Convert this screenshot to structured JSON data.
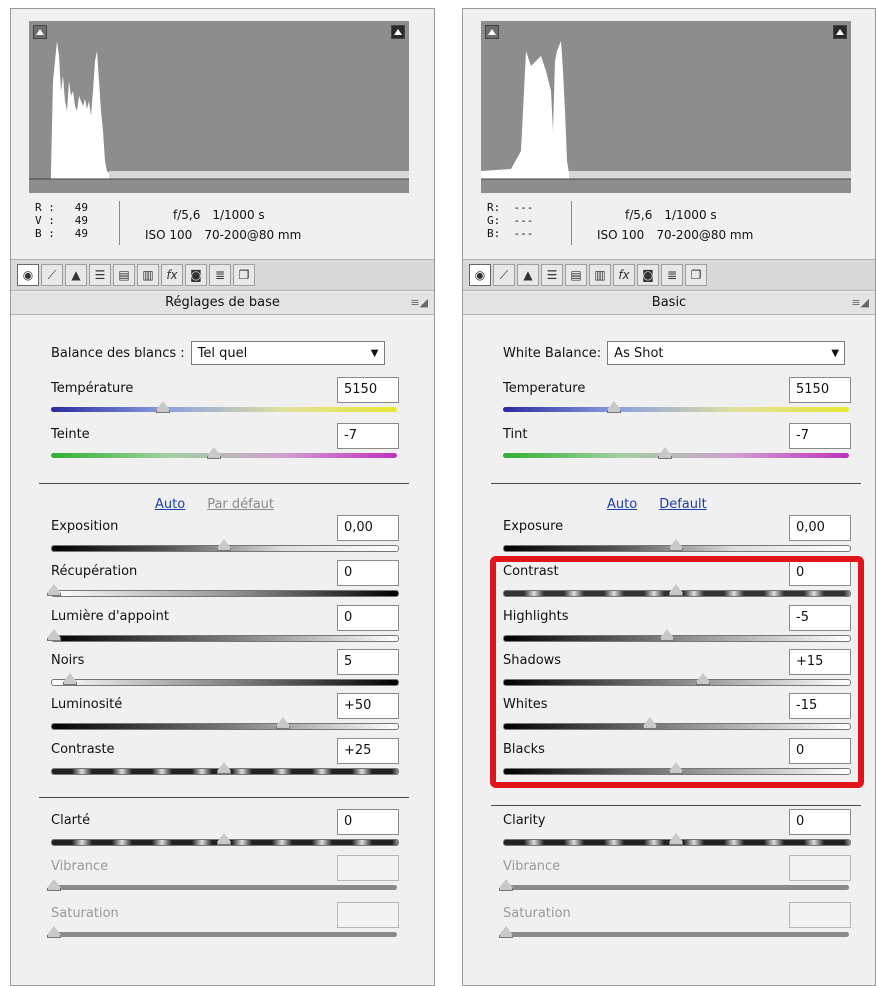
{
  "panels": {
    "fr": {
      "readout": {
        "r": "R :   49",
        "g": "V :   49",
        "b": "B :   49",
        "aperture": "f/5,6",
        "shutter": "1/1000 s",
        "iso": "ISO 100",
        "lens": "70-200@80 mm"
      },
      "section_title": "Réglages de base",
      "wb_label": "Balance des blancs :",
      "wb_value": "Tel quel",
      "auto": "Auto",
      "default": "Par défaut",
      "sliders": {
        "temp": {
          "label": "Température",
          "value": "5150"
        },
        "tint": {
          "label": "Teinte",
          "value": "-7"
        },
        "exposure": {
          "label": "Exposition",
          "value": "0,00"
        },
        "recovery": {
          "label": "Récupération",
          "value": "0"
        },
        "fill": {
          "label": "Lumière d'appoint",
          "value": "0"
        },
        "blacks": {
          "label": "Noirs",
          "value": "5"
        },
        "brightness": {
          "label": "Luminosité",
          "value": "+50"
        },
        "contrast": {
          "label": "Contraste",
          "value": "+25"
        },
        "clarity": {
          "label": "Clarté",
          "value": "0"
        },
        "vibrance": {
          "label": "Vibrance",
          "value": ""
        },
        "saturation": {
          "label": "Saturation",
          "value": ""
        }
      }
    },
    "en": {
      "readout": {
        "r": "R:  ---",
        "g": "G:  ---",
        "b": "B:  ---",
        "aperture": "f/5,6",
        "shutter": "1/1000 s",
        "iso": "ISO 100",
        "lens": "70-200@80 mm"
      },
      "section_title": "Basic",
      "wb_label": "White Balance:",
      "wb_value": "As Shot",
      "auto": "Auto",
      "default": "Default",
      "sliders": {
        "temp": {
          "label": "Temperature",
          "value": "5150"
        },
        "tint": {
          "label": "Tint",
          "value": "-7"
        },
        "exposure": {
          "label": "Exposure",
          "value": "0,00"
        },
        "contrast": {
          "label": "Contrast",
          "value": "0"
        },
        "highlights": {
          "label": "Highlights",
          "value": "-5"
        },
        "shadows": {
          "label": "Shadows",
          "value": "+15"
        },
        "whites": {
          "label": "Whites",
          "value": "-15"
        },
        "blacks": {
          "label": "Blacks",
          "value": "0"
        },
        "clarity": {
          "label": "Clarity",
          "value": "0"
        },
        "vibrance": {
          "label": "Vibrance",
          "value": ""
        },
        "saturation": {
          "label": "Saturation",
          "value": ""
        }
      }
    }
  },
  "toolbar_icons": [
    "basic-icon",
    "tone-curve-icon",
    "detail-icon",
    "hsl-icon",
    "split-toning-icon",
    "lens-corrections-icon",
    "effects-fx-icon",
    "camera-calibration-icon",
    "presets-icon",
    "snapshots-icon"
  ],
  "colors": {
    "highlight_box": "#e0141a",
    "link": "#1a3ea8"
  }
}
